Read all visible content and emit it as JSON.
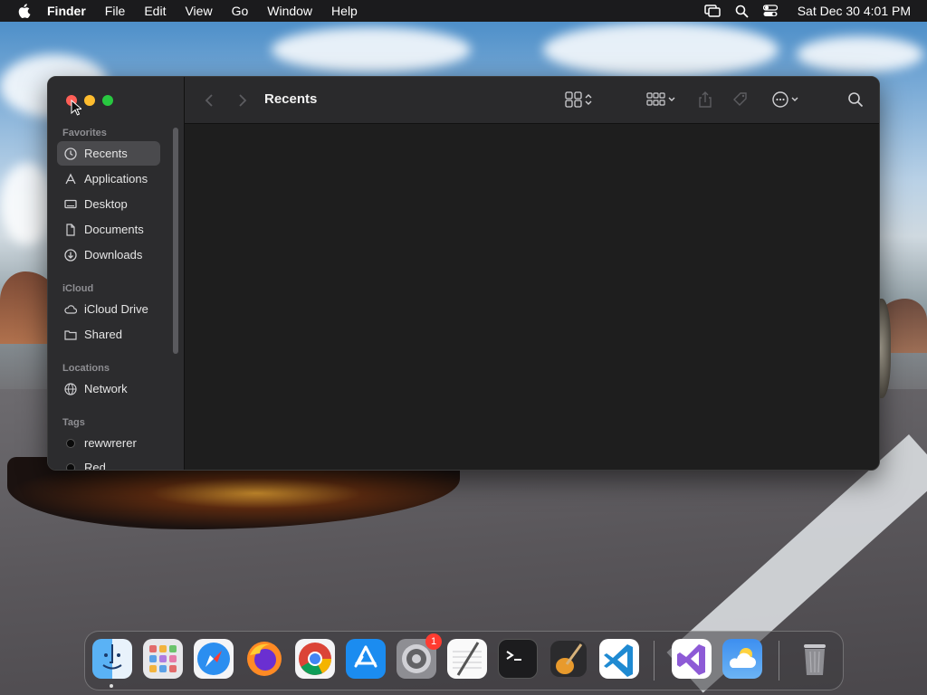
{
  "menubar": {
    "app_name": "Finder",
    "menus": [
      "File",
      "Edit",
      "View",
      "Go",
      "Window",
      "Help"
    ],
    "clock": "Sat Dec 30  4:01 PM"
  },
  "finder": {
    "title": "Recents",
    "sidebar": {
      "favorites_label": "Favorites",
      "favorites": [
        "Recents",
        "Applications",
        "Desktop",
        "Documents",
        "Downloads"
      ],
      "icloud_label": "iCloud",
      "icloud": [
        "iCloud Drive",
        "Shared"
      ],
      "locations_label": "Locations",
      "locations": [
        "Network"
      ],
      "tags_label": "Tags",
      "tags": [
        "rewwrerer",
        "Red"
      ]
    }
  },
  "dock": {
    "settings_badge": "1",
    "apps": [
      "finder-icon",
      "launchpad-icon",
      "safari-icon",
      "firefox-icon",
      "chrome-icon",
      "app-store-icon",
      "system-settings-icon",
      "textedit-icon",
      "terminal-icon",
      "garageband-icon",
      "vscode-icon",
      "visual-studio-icon",
      "weather-icon",
      "trash-icon"
    ]
  }
}
